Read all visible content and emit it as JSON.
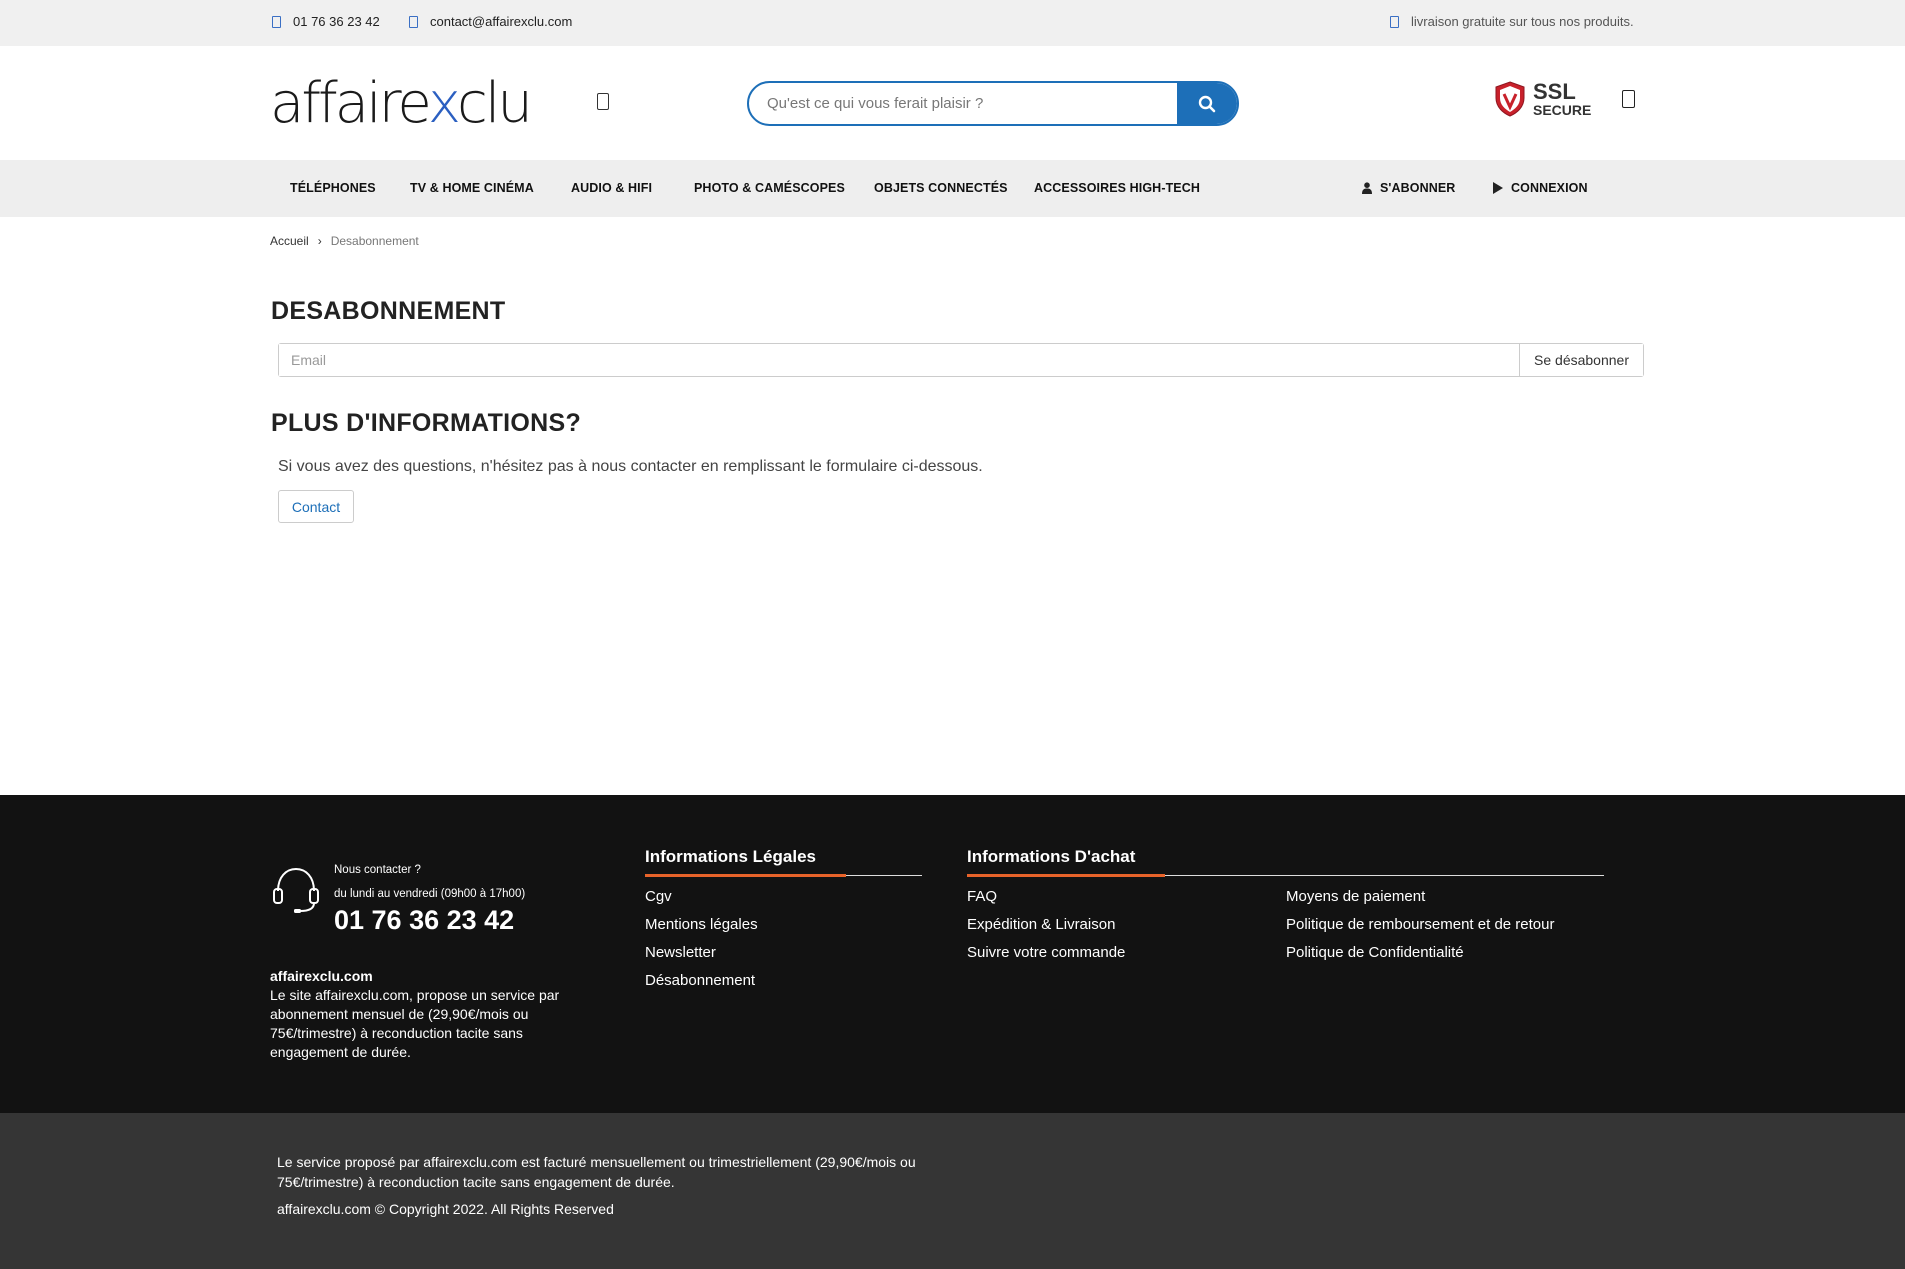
{
  "topbar": {
    "phone": "01 76 36 23 42",
    "email": "contact@affairexclu.com",
    "shipping": "livraison gratuite sur tous nos produits."
  },
  "header": {
    "logo_part1": "affaire",
    "logo_x": "x",
    "logo_part2": "clu",
    "search_placeholder": "Qu'est ce qui vous ferait plaisir ?",
    "ssl_line1": "SSL",
    "ssl_line2": "SECURE"
  },
  "nav": {
    "items": [
      "Téléphones",
      "TV & Home Cinéma",
      "Audio & HiFi",
      "Photo & Caméscopes",
      "Objets connectés",
      "Accessoires High-Tech"
    ],
    "subscribe": "S'abonner",
    "login": "Connexion"
  },
  "breadcrumb": {
    "home": "Accueil",
    "separator": "›",
    "current": "Desabonnement"
  },
  "main": {
    "title": "DESABONNEMENT",
    "email_placeholder": "Email",
    "unsubscribe_button": "Se désabonner",
    "more_title": "PLUS D'INFORMATIONS?",
    "info_text": "Si vous avez des questions, n'hésitez pas à nous contacter en remplissant le formulaire ci-dessous.",
    "contact_button": "Contact"
  },
  "footer": {
    "contact_prompt": "Nous contacter ?",
    "hours": "du lundi au vendredi (09h00 à 17h00)",
    "phone": "01 76 36 23 42",
    "brand": "affairexclu.com",
    "brand_desc": "Le site affairexclu.com, propose un service par abonnement mensuel de (29,90€/mois ou 75€/trimestre) à reconduction tacite sans engagement de durée.",
    "legal_title": "Informations Légales",
    "legal_links": [
      "Cgv",
      "Mentions légales",
      "Newsletter",
      "Désabonnement"
    ],
    "purchase_title": "Informations D'achat",
    "purchase_links_col1": [
      "FAQ",
      "Expédition & Livraison",
      "Suivre votre commande"
    ],
    "purchase_links_col2": [
      "Moyens de paiement",
      "Politique de remboursement et de retour",
      "Politique de Confidentialité"
    ],
    "bottom_text": "Le service proposé par affairexclu.com est facturé mensuellement ou trimestriellement (29,90€/mois ou 75€/trimestre) à reconduction tacite sans engagement de durée.",
    "copyright": "affairexclu.com © Copyright 2022. All Rights Reserved"
  },
  "colors": {
    "accent_blue": "#1d6fb8",
    "accent_orange": "#e8632a",
    "footer_bg": "#121212",
    "bottom_bg": "#353535"
  }
}
